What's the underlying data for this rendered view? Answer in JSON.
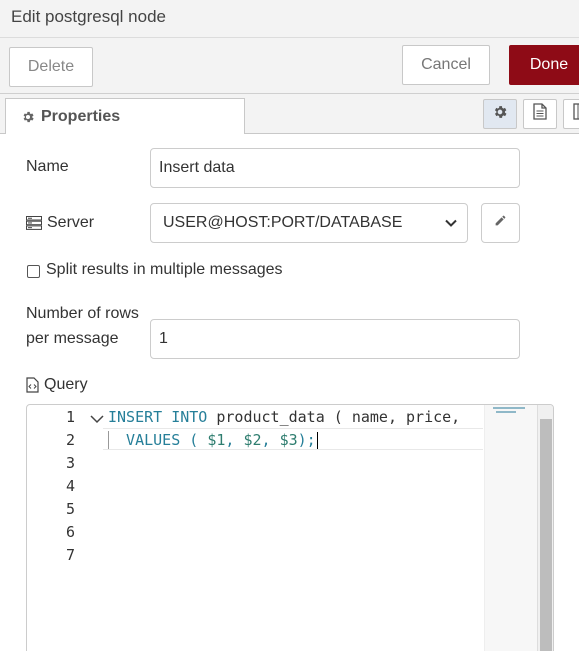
{
  "window": {
    "title": "Edit postgresql node"
  },
  "toolbar": {
    "delete_label": "Delete",
    "cancel_label": "Cancel",
    "done_label": "Done",
    "accent": "#8e0b16"
  },
  "tabs": {
    "properties_label": "Properties"
  },
  "form": {
    "name_label": "Name",
    "name_value": "Insert  data",
    "server_label": "Server",
    "server_value": "USER@HOST:PORT/DATABASE",
    "split_label": "Split results in multiple messages",
    "split_checked": false,
    "rows_label_line1": "Number of rows",
    "rows_label_line2": "per message",
    "rows_value": "1",
    "query_label": "Query"
  },
  "editor": {
    "line_numbers": [
      "1",
      "2",
      "3",
      "4",
      "5",
      "6",
      "7"
    ],
    "line1": {
      "kw": "INSERT INTO",
      "rest": " product_data ( name, price,"
    },
    "line2": {
      "pre": "  VALUES ( ",
      "v1": "$1",
      "c1": ", ",
      "v2": "$2",
      "c2": ", ",
      "v3": "$3",
      "post": ");"
    }
  },
  "icons": [
    "gear-icon",
    "document-icon",
    "layout-icon",
    "server-icon",
    "pencil-icon",
    "code-file-icon",
    "chevron-down-icon",
    "fold-chevron-icon"
  ]
}
